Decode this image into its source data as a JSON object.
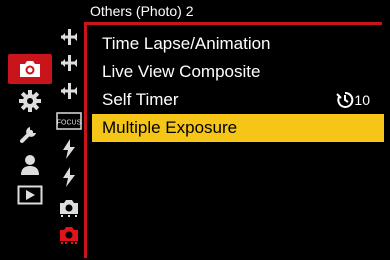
{
  "menu": {
    "title": "Others (Photo) 2",
    "items": [
      {
        "label": "Time Lapse/Animation",
        "value": ""
      },
      {
        "label": "Live View Composite",
        "value": ""
      },
      {
        "label": "Self Timer",
        "value": "10",
        "value_icon": "self-timer-icon"
      },
      {
        "label": "Multiple Exposure",
        "value": "",
        "selected": true
      }
    ]
  },
  "main_tabs": [
    {
      "icon": "camera-icon",
      "active": true
    },
    {
      "icon": "gear-icon"
    },
    {
      "icon": "wrench-icon"
    },
    {
      "icon": "person-icon"
    },
    {
      "icon": "playback-icon"
    }
  ],
  "sub_tabs": [
    {
      "icon": "af-area-icon"
    },
    {
      "icon": "af-area-icon"
    },
    {
      "icon": "af-area-icon"
    },
    {
      "icon": "focus-icon",
      "label": "FOCUS"
    },
    {
      "icon": "flash-icon"
    },
    {
      "icon": "flash-icon"
    },
    {
      "icon": "camera-other-icon"
    },
    {
      "icon": "camera-other-icon",
      "active": true
    }
  ],
  "colors": {
    "accent_red": "#c8141a",
    "highlight_yellow": "#f5c518"
  }
}
